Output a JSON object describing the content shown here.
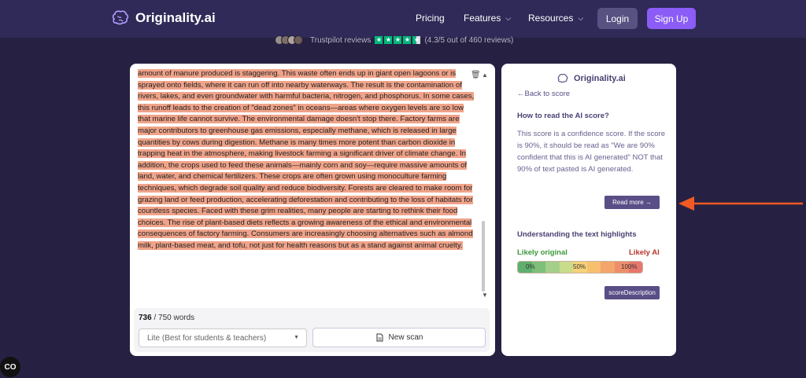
{
  "nav": {
    "brand": "Originality.ai",
    "links": [
      "Pricing",
      "Features",
      "Resources"
    ],
    "login": "Login",
    "signup": "Sign Up"
  },
  "trustpilot": {
    "label": "Trustpilot reviews",
    "rating_text": "(4.3/5 out of 460 reviews)",
    "rating": 4.3
  },
  "editor": {
    "text": "amount of manure produced is staggering. This waste often ends up in giant open lagoons or is sprayed onto fields, where it can run off into nearby waterways. The result is the contamination of rivers, lakes, and even groundwater with harmful bacteria, nitrogen, and phosphorus. In some cases, this runoff leads to the creation of \"dead zones\" in oceans—areas where oxygen levels are so low that marine life cannot survive. The environmental damage doesn't stop there. Factory farms are major contributors to greenhouse gas emissions, especially methane, which is released in large quantities by cows during digestion. Methane is many times more potent than carbon dioxide in trapping heat in the atmosphere, making livestock farming a significant driver of climate change. In addition, the crops used to feed these animals—mainly corn and soy—require massive amounts of land, water, and chemical fertilizers. These crops are often grown using monoculture farming techniques, which degrade soil quality and reduce biodiversity. Forests are cleared to make room for grazing land or feed production, accelerating deforestation and contributing to the loss of habitats for countless species. Faced with these grim realities, many people are starting to rethink their food choices. The rise of plant-based diets reflects a growing awareness of the ethical and environmental consequences of factory farming. Consumers are increasingly choosing alternatives such as almond milk, plant-based meat, and tofu, not just for health reasons but as a stand against animal cruelty.",
    "word_count": "736",
    "word_limit": "/ 750 words",
    "model_select": "Lite (Best for students & teachers)",
    "new_scan": "New scan"
  },
  "sidepanel": {
    "brand": "Originality.ai",
    "back": "Back to score",
    "how_title": "How to read the AI score?",
    "explanation": "This score is a confidence score. If the score is 90%, it should be read as \"We are 90% confident that this is AI generated\" NOT that 90% of text pasted is AI generated.",
    "read_more": "Read more →",
    "highlights_title": "Understanding the text highlights",
    "likely_original": "Likely original",
    "likely_ai": "Likely AI",
    "scale_labels": [
      "0%",
      "50%",
      "100%"
    ],
    "score_description": "scoreDescription"
  },
  "colors": {
    "nav_bg": "#2f2a57",
    "page_bg": "#262142",
    "highlight": "#f0a389",
    "accent": "#5a4e87",
    "signup": "#8b5cf6",
    "arrow": "#f15a22"
  },
  "scale_colors": [
    "#5fae6e",
    "#7ebf7a",
    "#a3cf8a",
    "#c9dc8c",
    "#f6d27a",
    "#f6c06f",
    "#f3a56b",
    "#ee8d6c",
    "#e6776d"
  ]
}
